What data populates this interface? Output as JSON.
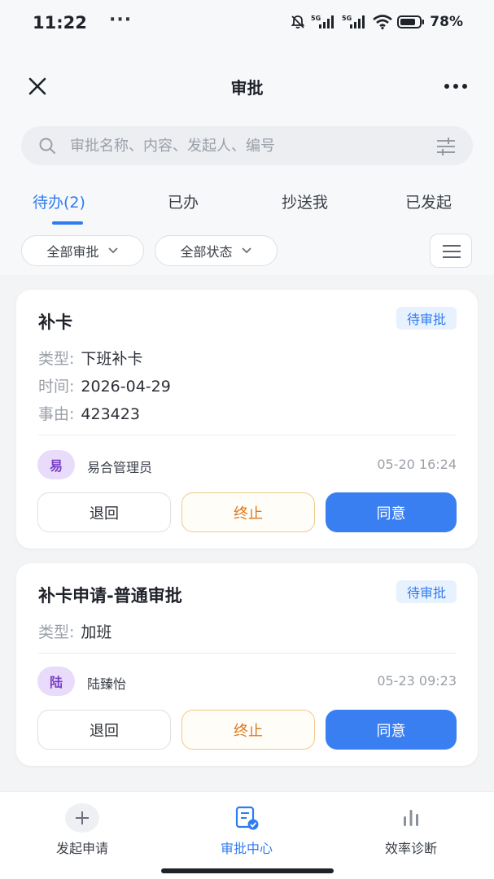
{
  "status_bar": {
    "time": "11:22",
    "dots": "···",
    "signal_1": "5G",
    "signal_2": "5G",
    "battery": "78%"
  },
  "header": {
    "title": "审批"
  },
  "search": {
    "placeholder": "审批名称、内容、发起人、编号"
  },
  "tabs": [
    {
      "label": "待办(2)",
      "active": true
    },
    {
      "label": "已办"
    },
    {
      "label": "抄送我"
    },
    {
      "label": "已发起"
    }
  ],
  "filters": {
    "approval_type": "全部审批",
    "status": "全部状态"
  },
  "cards": [
    {
      "title": "补卡",
      "badge": "待审批",
      "fields": [
        {
          "label": "类型:",
          "value": "下班补卡"
        },
        {
          "label": "时间:",
          "value": "2026-04-29"
        },
        {
          "label": "事由:",
          "value": "423423"
        }
      ],
      "avatar": "易",
      "user": "易合管理员",
      "time": "05-20 16:24",
      "actions": {
        "back": "退回",
        "stop": "终止",
        "agree": "同意"
      }
    },
    {
      "title": "补卡申请-普通审批",
      "badge": "待审批",
      "fields": [
        {
          "label": "类型:",
          "value": "加班"
        }
      ],
      "avatar": "陆",
      "user": "陆臻怡",
      "time": "05-23 09:23",
      "actions": {
        "back": "退回",
        "stop": "终止",
        "agree": "同意"
      }
    }
  ],
  "bottom_nav": [
    {
      "label": "发起申请",
      "icon": "plus-icon"
    },
    {
      "label": "审批中心",
      "icon": "approval-doc-icon",
      "active": true
    },
    {
      "label": "效率诊断",
      "icon": "bar-chart-icon"
    }
  ],
  "colors": {
    "accent": "#2f7cf0",
    "warning": "#d9791e",
    "avatar_bg": "#e9dcfb",
    "badge_bg": "#e8f1fe"
  }
}
